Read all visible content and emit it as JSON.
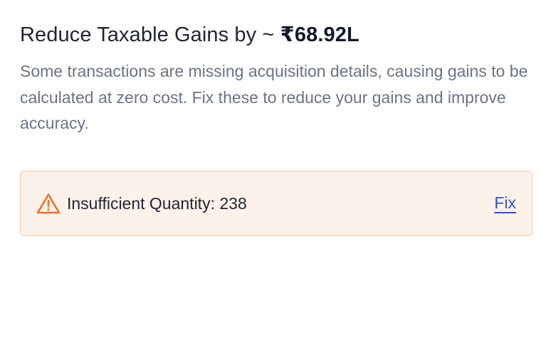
{
  "card": {
    "title_prefix": "Reduce Taxable Gains by ~ ",
    "title_amount": "₹68.92L",
    "description": "Some transactions are missing acquisition details, causing gains to be calculated at zero cost. Fix these to reduce your gains and improve accuracy."
  },
  "alert": {
    "icon": "warning-triangle-icon",
    "icon_color": "#e8742e",
    "message": "Insufficient Quantity: 238",
    "action_label": "Fix",
    "action_color": "#2f4fd8",
    "background_color": "#fdf2ea",
    "border_color": "#f2c7a7"
  }
}
